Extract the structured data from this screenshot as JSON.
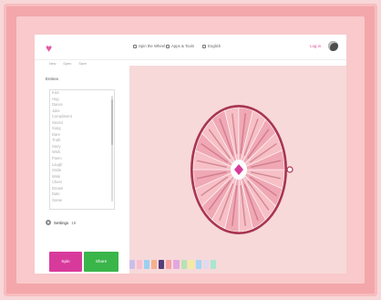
{
  "topbar": {
    "items": [
      {
        "label": "Spin the Wheel",
        "icon": "tag-icon"
      },
      {
        "label": "Apps & Tools",
        "icon": "grid-icon"
      },
      {
        "label": "English",
        "icon": "globe-icon"
      }
    ],
    "login": "Log in",
    "logo_icon": "heart-icon"
  },
  "subnav": {
    "items": [
      "New",
      "Open",
      "Save"
    ]
  },
  "sidebar": {
    "title": "Entries",
    "entries": [
      "Kiss",
      "Hug",
      "Dance",
      "Joke",
      "Compliment",
      "Secret",
      "Song",
      "Dare",
      "Truth",
      "Story",
      "Wish",
      "Poem",
      "Laugh",
      "Smile",
      "Wink",
      "Cheer",
      "Dream",
      "Date",
      "Game"
    ],
    "settings_label": "Settings",
    "count": "19"
  },
  "buttons": {
    "spin": "Spin",
    "share": "Share"
  },
  "colors": {
    "accent_pink": "#d83a9c",
    "accent_green": "#39b54a",
    "wheel_rim": "#a93551",
    "wheel_fill": "#f6c0c6",
    "wheel_alt": "#f0a8b5",
    "background": "#f7d9da"
  },
  "wheel": {
    "segments": 20
  },
  "palette": [
    {
      "color": "#cbbfe9"
    },
    {
      "color": "#f7c0d0"
    },
    {
      "color": "#9bd0f2"
    },
    {
      "color": "#f4b08f"
    },
    {
      "color": "#553d7b"
    },
    {
      "color": "#f7a1a1"
    },
    {
      "color": "#e2a7e0"
    },
    {
      "color": "#b7e3b0"
    },
    {
      "color": "#f2ec9d"
    },
    {
      "color": "#a6d6f1"
    },
    {
      "color": "#e0d9f0"
    },
    {
      "color": "#a9e6d0"
    }
  ]
}
